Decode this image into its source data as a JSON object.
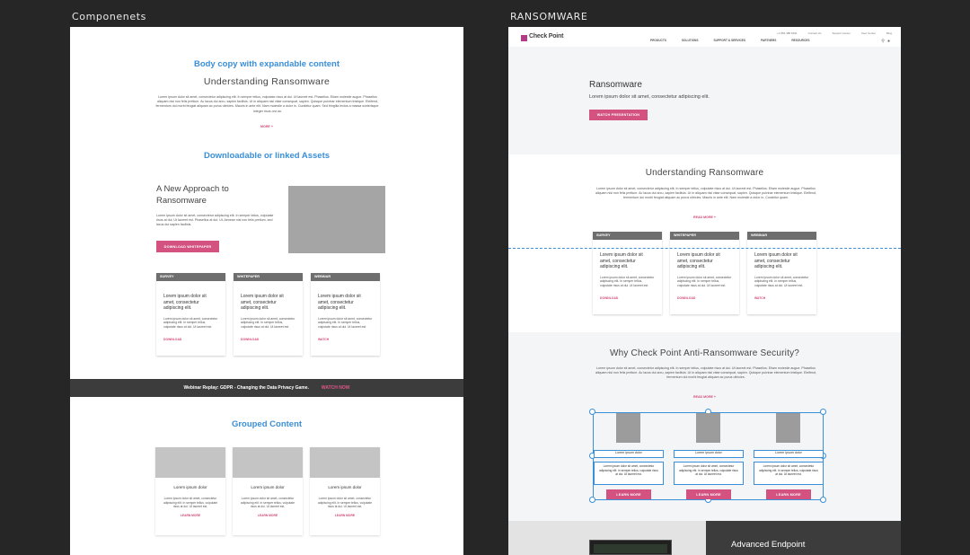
{
  "artboards": {
    "left_label": "Componenets",
    "right_label": "RANSOMWARE"
  },
  "left": {
    "section1": {
      "heading": "Body copy with expandable content",
      "title": "Understanding Ransomware",
      "body": "Lorem ipsum dolor sit amet, consectetur adipiscing elit. In semper tellus, vulputate risus at dui. Ut laoreet est. Phasellus. Etiam molestie augue. Phasellus aliquam nisl non felis pretium. Ac lacus dui arcu, sapien facilisis. Ut in aliquam nisl vitae consequat, sapien. Quisque pulvinar elementum tristique. Eleifend, fermentum dui morbi feugiat aliquam ac purus ultricies. Mauris in ante elit. Nam molestie a dolor in. Curabitur quam. Sed fringilla lectus a massa scelerisque. Integer risus orci ac.",
      "more": "MORE +"
    },
    "section2": {
      "heading": "Downloadable or linked Assets",
      "title": "A New Approach to Ransomware",
      "body": "Lorem ipsum dolor sit amet, consectetur adipiscing elit. In semper tellus, vulputate risus at dui. Ut laoreet est. Phasellus at dui. Ut. Aenean nisl non felis pretium, sed lacus dui sapien facilisis.",
      "button": "DOWNLOAD WHITEPAPER"
    },
    "cards": [
      {
        "tag": "SURVEY",
        "title": "Lorem ipsum dolor sit amet, consectetur adipiscing elit.",
        "body": "Lorem ipsum dolor sit amet, consectetur adipiscing elit. In semper tellus, vulputate risus at dui. Ut laoreet est.",
        "link": "DOWNLOAD"
      },
      {
        "tag": "WHITEPAPER",
        "title": "Lorem ipsum dolor sit amet, consectetur adipiscing elit.",
        "body": "Lorem ipsum dolor sit amet, consectetur adipiscing elit. In semper tellus, vulputate risus at dui. Ut laoreet est.",
        "link": "DOWNLOAD"
      },
      {
        "tag": "WEBINAR",
        "title": "Lorem ipsum dolor sit amet, consectetur adipiscing elit.",
        "body": "Lorem ipsum dolor sit amet, consectetur adipiscing elit. In semper tellus, vulputate risus at dui. Ut laoreet est.",
        "link": "WATCH"
      }
    ],
    "banner": {
      "label": "Webinar Replay:",
      "text": "GDPR - Changing the Data Privacy Game.",
      "cta": "WATCH NOW"
    },
    "grouped": {
      "heading": "Grouped Content",
      "items": [
        {
          "title": "Lorem ipsum dolor",
          "body": "Lorem ipsum dolor sit amet, consectetur adipiscing elit. In semper tellus, vulputate risus at dui. Ut laoreet est.",
          "link": "LEARN MORE"
        },
        {
          "title": "Lorem ipsum dolor",
          "body": "Lorem ipsum dolor sit amet, consectetur adipiscing elit. In semper tellus, vulputate risus at dui. Ut laoreet est.",
          "link": "LEARN MORE"
        },
        {
          "title": "Lorem ipsum dolor",
          "body": "Lorem ipsum dolor sit amet, consectetur adipiscing elit. In semper tellus, vulputate risus at dui. Ut laoreet est.",
          "link": "LEARN MORE"
        }
      ]
    }
  },
  "right": {
    "nav": {
      "logo": "Check Point",
      "util_links": [
        "+1 866 488 6691",
        "Contact Us",
        "Support Center",
        "User Center",
        "Blog"
      ],
      "main_links": [
        "PRODUCTS",
        "SOLUTIONS",
        "SUPPORT & SERVICES",
        "PARTNERS",
        "RESOURCES"
      ],
      "icons": [
        "search-icon",
        "user-icon"
      ]
    },
    "hero": {
      "title": "Ransomware",
      "subtitle": "Lorem ipsum dolor sit amet, consectetur adipiscing elit.",
      "button": "WATCH PRESENTATION"
    },
    "understanding": {
      "title": "Understanding Ransomware",
      "body": "Lorem ipsum dolor sit amet, consectetur adipiscing elit. In semper tellus, vulputate risus at dui. Ut laoreet est. Phasellus. Etiam molestie augue. Phasellus aliquam nisl non felis pretium. Ac lacus dui arcu, sapien facilisis. Ut in aliquam nisl vitae consequat, sapien. Quisque pulvinar elementum tristique. Eleifend, fermentum dui morbi feugiat aliquam ac purus ultricies. Mauris in ante elit. Nam molestie a dolor in. Curabitur quam.",
      "more": "READ MORE +"
    },
    "cards": [
      {
        "tag": "SURVEY",
        "title": "Lorem ipsum dolor sit amet, consectetur adipiscing elit.",
        "body": "Lorem ipsum dolor sit amet, consectetur adipiscing elit. In semper tellus, vulputate risus at dui. Ut laoreet est.",
        "link": "DOWNLOAD"
      },
      {
        "tag": "WHITEPAPER",
        "title": "Lorem ipsum dolor sit amet, consectetur adipiscing elit.",
        "body": "Lorem ipsum dolor sit amet, consectetur adipiscing elit. In semper tellus, vulputate risus at dui. Ut laoreet est.",
        "link": "DOWNLOAD"
      },
      {
        "tag": "WEBINAR",
        "title": "Lorem ipsum dolor sit amet, consectetur adipiscing elit.",
        "body": "Lorem ipsum dolor sit amet, consectetur adipiscing elit. In semper tellus, vulputate risus at dui. Ut laoreet est.",
        "link": "WATCH"
      }
    ],
    "why": {
      "title": "Why Check Point Anti-Ransomware Security?",
      "body": "Lorem ipsum dolor sit amet, consectetur adipiscing elit. In semper tellus, vulputate risus at dui. Ut laoreet est. Phasellus. Etiam molestie augue. Phasellus aliquam nisl non felis pretium. Ac lacus dui arcu, sapien facilisis. Ut in aliquam nisl vitae consequat, sapien. Quisque pulvinar elementum tristique. Eleifend, fermentum dui morbi feugiat aliquam ac purus ultricies.",
      "more": "READ MORE +",
      "items": [
        {
          "title": "Lorem ipsum dolor",
          "body": "Lorem ipsum dolor sit amet, consectetur adipiscing elit. In semper tellus, vulputate risus at dui. Ut laoreet est.",
          "button": "LEARN MORE"
        },
        {
          "title": "Lorem ipsum dolor",
          "body": "Lorem ipsum dolor sit amet, consectetur adipiscing elit. In semper tellus, vulputate risus at dui. Ut laoreet est.",
          "button": "LEARN MORE"
        },
        {
          "title": "Lorem ipsum dolor",
          "body": "Lorem ipsum dolor sit amet, consectetur adipiscing elit. In semper tellus, vulputate risus at dui. Ut laoreet est.",
          "button": "LEARN MORE"
        }
      ]
    },
    "bottom": {
      "title": "Advanced Endpoint"
    }
  },
  "colors": {
    "accent_blue": "#3a8fd8",
    "brand_pink": "#d4527f",
    "card_head_gray": "#6e6e6e",
    "canvas": "#262626"
  }
}
